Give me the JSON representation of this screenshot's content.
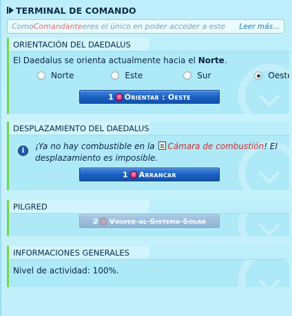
{
  "header": {
    "title": "TERMINAL DE COMANDO"
  },
  "tip": {
    "prefix": "Como ",
    "highlight": "Comandante",
    "suffix": " eres el único en poder acceder a este",
    "more_link": "Leer más..."
  },
  "orientation": {
    "heading": "ORIENTACIÓN DEL DAEDALUS",
    "text_prefix": "El Daedalus se orienta actualmente hacia el ",
    "current": "Norte",
    "text_suffix": ".",
    "options": [
      {
        "label": "Norte",
        "selected": false
      },
      {
        "label": "Este",
        "selected": false
      },
      {
        "label": "Sur",
        "selected": false
      },
      {
        "label": "Oeste",
        "selected": true
      }
    ],
    "button": {
      "cost": "1",
      "label": "Orientar : Oeste"
    }
  },
  "displacement": {
    "heading": "DESPLAZAMIENTO DEL DAEDALUS",
    "warning_part1": "¡Ya no hay combustible en la ",
    "warning_link": "Cámara de combustión",
    "warning_part2": "! El desplazamiento es imposible.",
    "button": {
      "cost": "1",
      "label": "Arrancar"
    }
  },
  "pilgred": {
    "heading": "PILGRED",
    "button": {
      "cost": "2",
      "label": "Volver al Sistema Solar",
      "disabled": true
    }
  },
  "general": {
    "heading": "INFORMACIONES GENERALES",
    "activity": "Nivel de actividad: 100%."
  }
}
